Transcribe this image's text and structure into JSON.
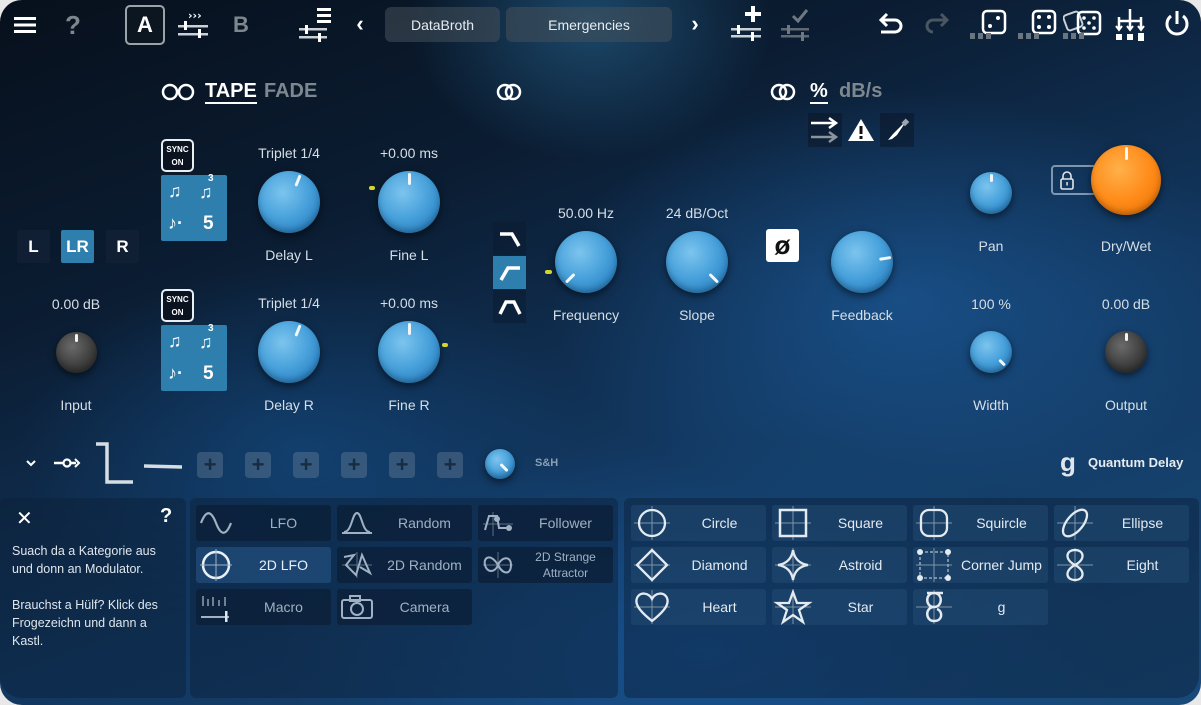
{
  "topbar": {
    "ab_a": "A",
    "ab_b": "B",
    "preset_bank": "DataBroth",
    "preset_name": "Emergencies",
    "help": "?",
    "prev": "‹",
    "next": "›"
  },
  "delay": {
    "mode_tape": "TAPE",
    "mode_fade": "FADE",
    "sync_top": "SYNC",
    "sync_bottom": "ON",
    "note_triplet_num": "3",
    "note_count": "5",
    "delay_l": {
      "value": "Triplet 1/4",
      "label": "Delay L",
      "position": 0.58
    },
    "fine_l": {
      "value": "+0.00 ms",
      "label": "Fine L",
      "position": 0.5
    },
    "delay_r": {
      "value": "Triplet 1/4",
      "label": "Delay R",
      "position": 0.58
    },
    "fine_r": {
      "value": "+0.00 ms",
      "label": "Fine R",
      "position": 0.5
    }
  },
  "channels": {
    "l": "L",
    "lr": "LR",
    "r": "R",
    "selected": "LR"
  },
  "input": {
    "value": "0.00 dB",
    "label": "Input",
    "position": 0.5
  },
  "filter": {
    "frequency": {
      "value": "50.00 Hz",
      "label": "Frequency",
      "position": 0.0
    },
    "slope": {
      "value": "24 dB/Oct",
      "label": "Slope",
      "position": 1.0
    },
    "selected_type": "high-pass"
  },
  "feedback": {
    "units_percent": "%",
    "units_dbs": "dB/s",
    "phase": "ø",
    "label": "Feedback",
    "position": 0.8
  },
  "output_section": {
    "pan": {
      "label": "Pan",
      "position": 0.5
    },
    "drywet": {
      "label": "Dry/Wet",
      "position": 0.5
    },
    "width": {
      "value": "100 %",
      "label": "Width",
      "position": 1.0
    },
    "output": {
      "value": "0.00 dB",
      "label": "Output",
      "position": 0.5
    }
  },
  "modrow": {
    "sh_label": "S&H",
    "plus": "+",
    "brand": "Quantum Delay",
    "brand_logo": "g"
  },
  "help_panel": {
    "close": "✕",
    "help": "?",
    "text1": "Suach da a Kategorie aus und donn an Modulator.",
    "text2": "Brauchst a Hülf? Klick des Frogezeichn und dann a Kastl."
  },
  "modulators": [
    {
      "label": "LFO",
      "icon": "sine-wave-icon"
    },
    {
      "label": "Random",
      "icon": "bell-curve-icon"
    },
    {
      "label": "Follower",
      "icon": "follower-icon"
    },
    {
      "label": "2D LFO",
      "icon": "crosshair-circle-icon",
      "selected": true
    },
    {
      "label": "2D Random",
      "icon": "random-path-icon"
    },
    {
      "label": "2D Strange Attractor",
      "icon": "attractor-icon"
    },
    {
      "label": "Macro",
      "icon": "macro-slider-icon"
    },
    {
      "label": "Camera",
      "icon": "camera-icon"
    }
  ],
  "shapes": [
    {
      "label": "Circle"
    },
    {
      "label": "Square"
    },
    {
      "label": "Squircle"
    },
    {
      "label": "Ellipse"
    },
    {
      "label": "Diamond"
    },
    {
      "label": "Astroid"
    },
    {
      "label": "Corner Jump"
    },
    {
      "label": "Eight"
    },
    {
      "label": "Heart"
    },
    {
      "label": "Star"
    },
    {
      "label": "g"
    }
  ],
  "colors": {
    "accent": "#2e7fae",
    "knob": "#4aa3dc",
    "drywet": "#ff8c1a"
  }
}
